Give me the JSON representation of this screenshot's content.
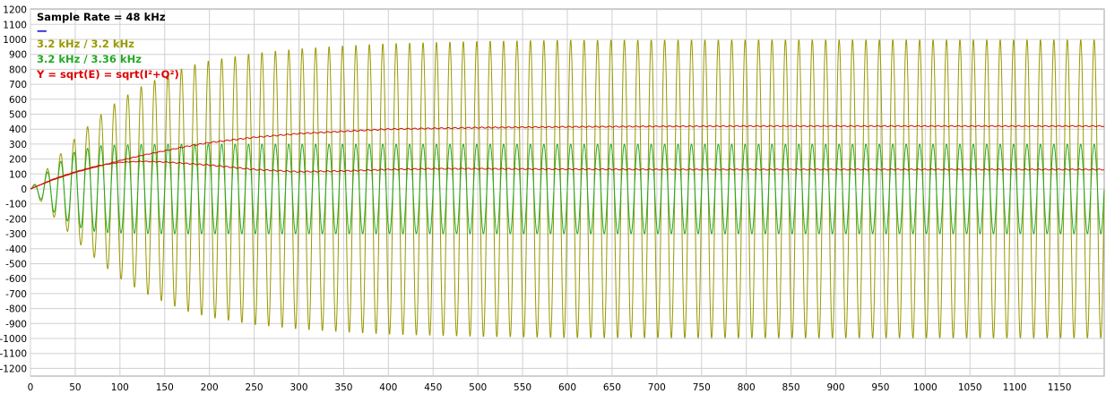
{
  "chart_data": {
    "type": "line",
    "title": "",
    "xlabel": "",
    "ylabel": "",
    "xlim": [
      0,
      1200
    ],
    "ylim": [
      -1200,
      1200
    ],
    "x_ticks": [
      0,
      50,
      100,
      150,
      200,
      250,
      300,
      350,
      400,
      450,
      500,
      550,
      600,
      650,
      700,
      750,
      800,
      850,
      900,
      950,
      1000,
      1050,
      1100,
      1150
    ],
    "y_ticks": [
      1200,
      1100,
      1000,
      900,
      800,
      700,
      600,
      500,
      400,
      300,
      200,
      100,
      0,
      -100,
      -200,
      -300,
      -400,
      -500,
      -600,
      -700,
      -800,
      -900,
      -1000,
      -1100,
      -1200
    ],
    "grid": true,
    "legend_position": "top-left",
    "legend": [
      {
        "text": "Sample Rate = 48 kHz",
        "color": "#000000"
      },
      {
        "text": "—",
        "color": "#0000cc"
      },
      {
        "text": "3.2 kHz / 3.2 kHz",
        "color": "#999900"
      },
      {
        "text": "3.2 kHz / 3.36 kHz",
        "color": "#22aa22"
      },
      {
        "text": "Y = sqrt(E) = sqrt(I²+Q²)",
        "color": "#dd0000"
      }
    ],
    "series": [
      {
        "label_ref": "3.2 kHz / 3.2 kHz",
        "color": "#999900",
        "kind": "oscillation",
        "period": 15,
        "envelope_points": [
          [
            0,
            0
          ],
          [
            25,
            180
          ],
          [
            50,
            340
          ],
          [
            75,
            480
          ],
          [
            100,
            600
          ],
          [
            125,
            690
          ],
          [
            150,
            760
          ],
          [
            175,
            820
          ],
          [
            200,
            860
          ],
          [
            250,
            910
          ],
          [
            300,
            940
          ],
          [
            350,
            960
          ],
          [
            400,
            975
          ],
          [
            500,
            990
          ],
          [
            600,
            998
          ],
          [
            800,
            1000
          ],
          [
            1200,
            1000
          ]
        ]
      },
      {
        "label_ref": "3.2 kHz / 3.36 kHz",
        "color": "#22aa22",
        "kind": "oscillation",
        "period": 15,
        "envelope_points": [
          [
            0,
            0
          ],
          [
            25,
            150
          ],
          [
            50,
            250
          ],
          [
            75,
            290
          ],
          [
            100,
            295
          ],
          [
            150,
            300
          ],
          [
            200,
            300
          ],
          [
            1200,
            300
          ]
        ]
      },
      {
        "label_ref": "Y = sqrt(E) = sqrt(I²+Q²)",
        "color": "#cc1100",
        "kind": "line",
        "points": [
          [
            0,
            0
          ],
          [
            25,
            60
          ],
          [
            50,
            110
          ],
          [
            75,
            150
          ],
          [
            100,
            190
          ],
          [
            125,
            225
          ],
          [
            150,
            255
          ],
          [
            175,
            285
          ],
          [
            200,
            310
          ],
          [
            250,
            345
          ],
          [
            300,
            370
          ],
          [
            350,
            385
          ],
          [
            400,
            400
          ],
          [
            450,
            405
          ],
          [
            500,
            410
          ],
          [
            600,
            415
          ],
          [
            700,
            418
          ],
          [
            800,
            420
          ],
          [
            1000,
            420
          ],
          [
            1200,
            420
          ]
        ]
      },
      {
        "label_ref": "Y = sqrt(E) = sqrt(I²+Q²)",
        "color": "#cc1100",
        "kind": "line",
        "points": [
          [
            0,
            0
          ],
          [
            25,
            65
          ],
          [
            50,
            115
          ],
          [
            75,
            155
          ],
          [
            100,
            178
          ],
          [
            125,
            185
          ],
          [
            150,
            180
          ],
          [
            175,
            170
          ],
          [
            200,
            160
          ],
          [
            250,
            130
          ],
          [
            300,
            115
          ],
          [
            350,
            120
          ],
          [
            400,
            130
          ],
          [
            450,
            135
          ],
          [
            500,
            135
          ],
          [
            600,
            132
          ],
          [
            700,
            130
          ],
          [
            800,
            130
          ],
          [
            1000,
            130
          ],
          [
            1200,
            130
          ]
        ]
      }
    ]
  }
}
